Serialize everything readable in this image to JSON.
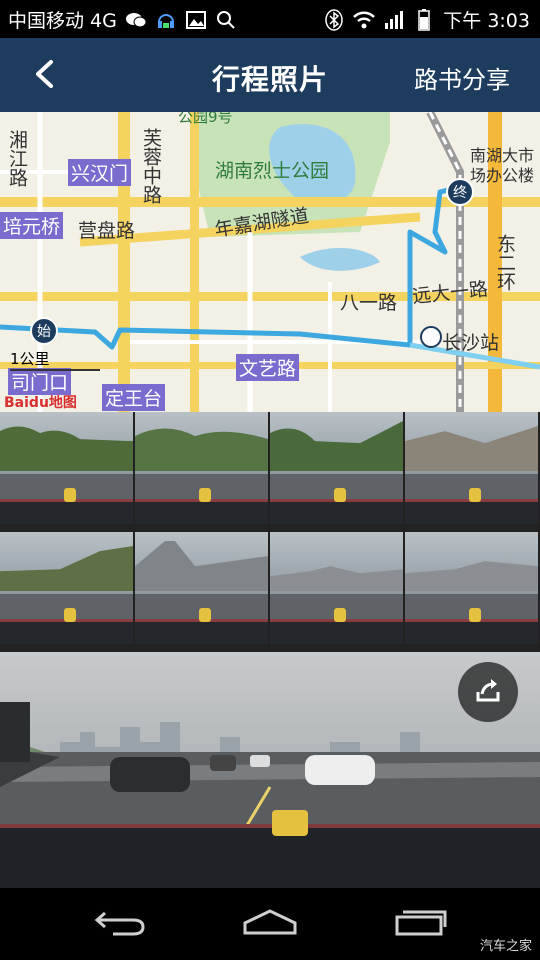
{
  "status_bar": {
    "carrier": "中国移动 4G",
    "time": "下午 3:03",
    "network": "4G",
    "icons": [
      "wechat-icon",
      "headset-icon",
      "gallery-icon",
      "search-icon",
      "bluetooth-icon",
      "wifi-icon",
      "signal-icon",
      "battery-icon"
    ]
  },
  "header": {
    "title": "行程照片",
    "right_action": "路书分享",
    "back_icon": "chevron-left-icon",
    "background": "#1e3d5e"
  },
  "map": {
    "labels": {
      "xinghanmen": "兴汉门",
      "peiyuanqiao": "培元桥",
      "furong_zhong": "芙蓉中路",
      "yingpan": "营盘路",
      "martyrs_park": "湖南烈士公园",
      "nianjiahu": "年嘉湖隧道",
      "park_gate": "公园9号",
      "bayi": "八一路",
      "yuanyi": "远大一路",
      "changsha_station": "长沙站",
      "wenyi": "文艺路",
      "dingwangtai": "定王台",
      "simenkou": "司门口",
      "nanhu_plaza": "南湖大市场办公楼",
      "dong_er_huan": "东二环",
      "xiang_jiang": "湘江路"
    },
    "start_marker": "始",
    "end_marker": "终",
    "scale": "1公里",
    "logo": "Baidu地图",
    "route_color": "#3da7e0"
  },
  "thumbnails": {
    "count": 8,
    "selected_index": 6
  },
  "photo": {
    "share_icon": "share-icon"
  },
  "navbar": {
    "back_icon": "back-arrow-icon",
    "home_icon": "home-icon",
    "recents_icon": "recents-icon",
    "watermark": "汽车之家"
  }
}
